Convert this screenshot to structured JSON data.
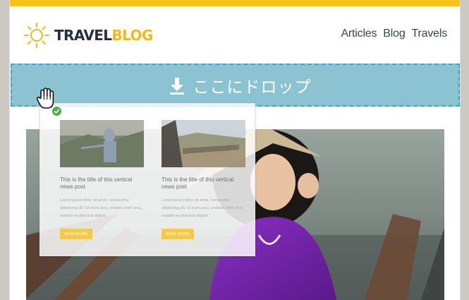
{
  "header": {
    "logo_travel": "TRAVEL",
    "logo_blog": "BLOG",
    "nav": [
      "Articles",
      "Blog",
      "Travels"
    ]
  },
  "dropzone": {
    "label": "ここにドロップ",
    "icon": "download-arrow-icon"
  },
  "drag_preview": {
    "cards": [
      {
        "title": "This is the title of this vertical news post",
        "body": "Lorem ipsum dolor sit amet, consectetur adipiscing elit. Ut enim arcu, sodales enim arcu, sodales eu placerat aliquet.",
        "button": "READ MORE"
      },
      {
        "title": "This is the title of this vertical news post",
        "body": "Lorem ipsum dolor sit amet, consectetur adipiscing elit. Ut enim arcu, sodales enim arcu, sodales eu placerat aliquet.",
        "button": "READ MORE"
      }
    ]
  },
  "colors": {
    "accent_yellow": "#f6c31b",
    "logo_dark": "#27313d",
    "dropzone_bg": "#8bc3d2",
    "dropzone_border": "#3fa6cf",
    "success_green": "#4caf50"
  }
}
